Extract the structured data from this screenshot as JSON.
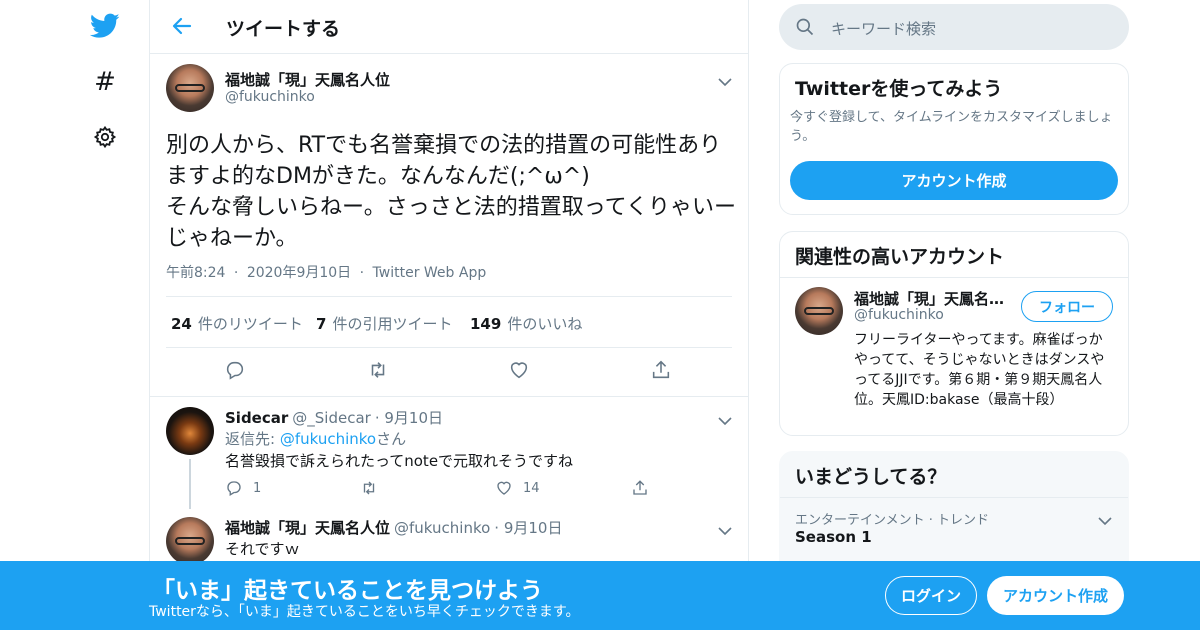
{
  "colors": {
    "accent": "#1da1f2",
    "text": "#14171a",
    "muted": "#657786",
    "border": "#e6ecf0"
  },
  "nav": {
    "icons": [
      "twitter-bird-icon",
      "hashtag-icon",
      "gear-icon"
    ],
    "hash_glyph": "#"
  },
  "header": {
    "title": "ツイートする"
  },
  "tweet": {
    "name": "福地誠「現」天鳳名人位",
    "handle": "@fukuchinko",
    "text": "別の人から、RTでも名誉棄損での法的措置の可能性ありますよ的なDMがきた。なんなんだ(;^ω^)\nそんな脅しいらねー。さっさと法的措置取ってくりゃいーじゃねーか。",
    "time": "午前8:24",
    "date": "2020年9月10日",
    "source": "Twitter Web App",
    "sep": "·",
    "stats": [
      {
        "count": "24",
        "label": "件のリツイート"
      },
      {
        "count": "7",
        "label": "件の引用ツイート"
      },
      {
        "count": "149",
        "label": "件のいいね"
      }
    ]
  },
  "replies": [
    {
      "name": "Sidecar",
      "handle": "@_Sidecar",
      "date": "· 9月10日",
      "reply_to_prefix": "返信先: ",
      "reply_to_handle": "@fukuchinko",
      "reply_to_suffix": "さん",
      "text": "名誉毀損で訴えられたってnoteで元取れそうですね",
      "reply_count": "1",
      "like_count": "14"
    },
    {
      "name": "福地誠「現」天鳳名人位",
      "handle": "@fukuchinko",
      "date": "· 9月10日",
      "text": "それですｗ"
    }
  ],
  "sidebar": {
    "search_placeholder": "キーワード検索",
    "signup_card": {
      "title": "Twitterを使ってみよう",
      "desc": "今すぐ登録して、タイムラインをカスタマイズしましょう。",
      "button": "アカウント作成"
    },
    "related_card": {
      "title": "関連性の高いアカウント",
      "name": "福地誠「現」天鳳名人位",
      "handle": "@fukuchinko",
      "follow": "フォロー",
      "bio": "フリーライターやってます。麻雀ばっかやってて、そうじゃないときはダンスやってるJJIです。第６期・第９期天鳳名人位。天鳳ID:bakase（最高十段）"
    },
    "trends_card": {
      "title": "いまどうしてる？",
      "category": "エンターテインメント · トレンド",
      "name": "Season 1"
    }
  },
  "banner": {
    "title": "「いま」起きていることを見つけよう",
    "sub": "Twitterなら、「いま」起きていることをいち早くチェックできます。",
    "login": "ログイン",
    "signup": "アカウント作成"
  }
}
